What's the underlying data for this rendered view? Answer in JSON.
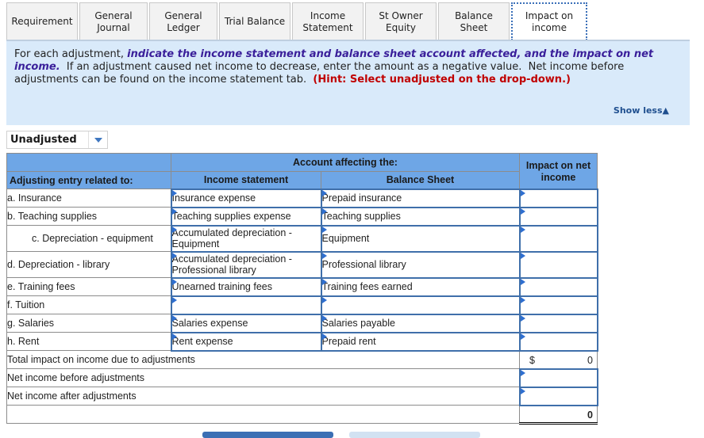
{
  "tabs": [
    {
      "label": "Requirement",
      "active": false
    },
    {
      "label": "General Journal",
      "active": false
    },
    {
      "label": "General Ledger",
      "active": false
    },
    {
      "label": "Trial Balance",
      "active": false
    },
    {
      "label": "Income Statement",
      "active": false
    },
    {
      "label": "St Owner Equity",
      "active": false
    },
    {
      "label": "Balance Sheet",
      "active": false
    },
    {
      "label": "Impact on income",
      "active": true
    }
  ],
  "instructions": {
    "lead": "For each adjustment, ",
    "emphasis": "indicate the income statement and balance sheet account affected, and the impact on net income.",
    "body": "  If an adjustment caused net income to decrease, enter the amount as a negative value.  Net income before adjustments can be found on the income statement tab.  ",
    "hint": "(Hint:  Select unadjusted on the drop-down.)",
    "show_less": "Show less",
    "show_less_icon": "▲"
  },
  "dropdown": {
    "selected": "Unadjusted"
  },
  "table": {
    "header_group": "Account affecting the:",
    "col_entry": "Adjusting entry related to:",
    "col_income": "Income statement",
    "col_balance": "Balance Sheet",
    "col_impact": "Impact on net income",
    "rows": [
      {
        "label": "a.  Insurance",
        "income": "Insurance expense",
        "balance": "Prepaid insurance",
        "impact": ""
      },
      {
        "label": "b.  Teaching supplies",
        "income": "Teaching supplies expense",
        "balance": "Teaching supplies",
        "impact": ""
      },
      {
        "label": "c.  Depreciation - equipment",
        "income": "Accumulated depreciation - Equipment",
        "balance": "Equipment",
        "impact": ""
      },
      {
        "label": "d.  Depreciation - library",
        "income": "Accumulated depreciation - Professional library",
        "balance": "Professional library",
        "impact": ""
      },
      {
        "label": "e.  Training fees",
        "income": "Unearned training fees",
        "balance": "Training fees earned",
        "impact": ""
      },
      {
        "label": "f.  Tuition",
        "income": "",
        "balance": "",
        "impact": ""
      },
      {
        "label": "g.  Salaries",
        "income": "Salaries expense",
        "balance": "Salaries payable",
        "impact": ""
      },
      {
        "label": "h.  Rent",
        "income": "Rent expense",
        "balance": "Prepaid rent",
        "impact": ""
      }
    ],
    "total_label": "Total impact on income due to adjustments",
    "total_currency": "$",
    "total_value": "0",
    "before_label": "Net income before adjustments",
    "before_value": "",
    "after_label": "Net income after adjustments",
    "after_value": "",
    "final_value": "0"
  }
}
